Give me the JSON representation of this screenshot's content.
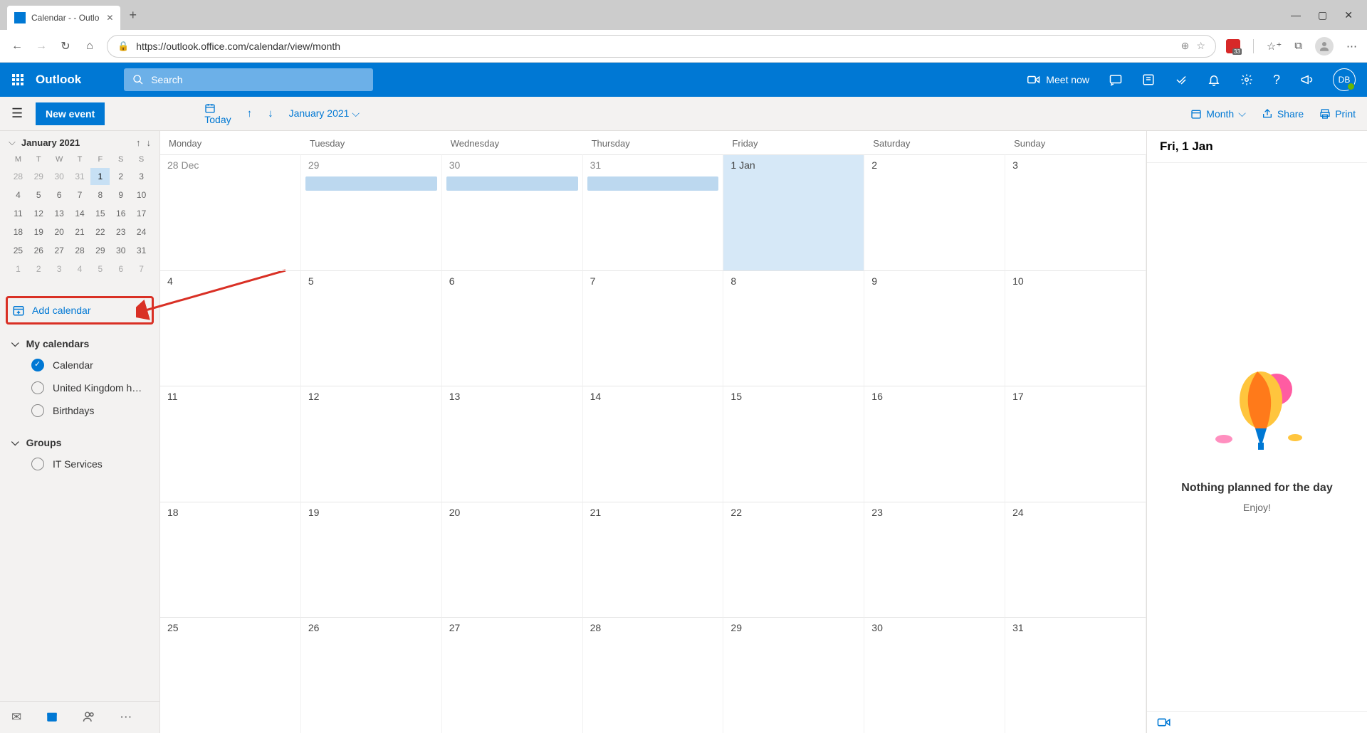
{
  "browser": {
    "tab_title": "Calendar -                  - Outlo",
    "url": "https://outlook.office.com/calendar/view/month",
    "extension_badge": "33"
  },
  "suite": {
    "brand": "Outlook",
    "search_placeholder": "Search",
    "meet_now": "Meet now",
    "user_initials": "DB"
  },
  "cmdbar": {
    "new_event": "New event",
    "today": "Today",
    "month_label": "January 2021",
    "view": "Month",
    "share": "Share",
    "print": "Print"
  },
  "mini_calendar": {
    "title": "January 2021",
    "day_headers": [
      "M",
      "T",
      "W",
      "T",
      "F",
      "S",
      "S"
    ],
    "weeks": [
      [
        {
          "d": "28",
          "dim": true
        },
        {
          "d": "29",
          "dim": true
        },
        {
          "d": "30",
          "dim": true
        },
        {
          "d": "31",
          "dim": true
        },
        {
          "d": "1",
          "sel": true
        },
        {
          "d": "2"
        },
        {
          "d": "3"
        }
      ],
      [
        {
          "d": "4"
        },
        {
          "d": "5"
        },
        {
          "d": "6"
        },
        {
          "d": "7"
        },
        {
          "d": "8"
        },
        {
          "d": "9"
        },
        {
          "d": "10"
        }
      ],
      [
        {
          "d": "11"
        },
        {
          "d": "12"
        },
        {
          "d": "13"
        },
        {
          "d": "14"
        },
        {
          "d": "15"
        },
        {
          "d": "16"
        },
        {
          "d": "17"
        }
      ],
      [
        {
          "d": "18"
        },
        {
          "d": "19"
        },
        {
          "d": "20"
        },
        {
          "d": "21"
        },
        {
          "d": "22"
        },
        {
          "d": "23"
        },
        {
          "d": "24"
        }
      ],
      [
        {
          "d": "25"
        },
        {
          "d": "26"
        },
        {
          "d": "27"
        },
        {
          "d": "28"
        },
        {
          "d": "29"
        },
        {
          "d": "30"
        },
        {
          "d": "31"
        }
      ],
      [
        {
          "d": "1",
          "dim": true
        },
        {
          "d": "2",
          "dim": true
        },
        {
          "d": "3",
          "dim": true
        },
        {
          "d": "4",
          "dim": true
        },
        {
          "d": "5",
          "dim": true
        },
        {
          "d": "6",
          "dim": true
        },
        {
          "d": "7",
          "dim": true
        }
      ]
    ]
  },
  "add_calendar": "Add calendar",
  "sections": {
    "my_calendars": {
      "title": "My calendars",
      "items": [
        {
          "label": "Calendar",
          "checked": true
        },
        {
          "label": "United Kingdom holid...",
          "checked": false
        },
        {
          "label": "Birthdays",
          "checked": false
        }
      ]
    },
    "groups": {
      "title": "Groups",
      "items": [
        {
          "label": "IT Services",
          "checked": false
        }
      ]
    }
  },
  "month_view": {
    "weekday_headers": [
      "Monday",
      "Tuesday",
      "Wednesday",
      "Thursday",
      "Friday",
      "Saturday",
      "Sunday"
    ],
    "cells": [
      {
        "label": "28 Dec",
        "dim": true
      },
      {
        "label": "29",
        "dim": true,
        "event": true
      },
      {
        "label": "30",
        "dim": true,
        "event": true
      },
      {
        "label": "31",
        "dim": true,
        "event": true
      },
      {
        "label": "1 Jan",
        "today": true
      },
      {
        "label": "2"
      },
      {
        "label": "3"
      },
      {
        "label": "4"
      },
      {
        "label": "5"
      },
      {
        "label": "6"
      },
      {
        "label": "7"
      },
      {
        "label": "8"
      },
      {
        "label": "9"
      },
      {
        "label": "10"
      },
      {
        "label": "11"
      },
      {
        "label": "12"
      },
      {
        "label": "13"
      },
      {
        "label": "14"
      },
      {
        "label": "15"
      },
      {
        "label": "16"
      },
      {
        "label": "17"
      },
      {
        "label": "18"
      },
      {
        "label": "19"
      },
      {
        "label": "20"
      },
      {
        "label": "21"
      },
      {
        "label": "22"
      },
      {
        "label": "23"
      },
      {
        "label": "24"
      },
      {
        "label": "25"
      },
      {
        "label": "26"
      },
      {
        "label": "27"
      },
      {
        "label": "28"
      },
      {
        "label": "29"
      },
      {
        "label": "30"
      },
      {
        "label": "31"
      }
    ]
  },
  "agenda": {
    "header": "Fri, 1 Jan",
    "nothing": "Nothing planned for the day",
    "enjoy": "Enjoy!"
  }
}
